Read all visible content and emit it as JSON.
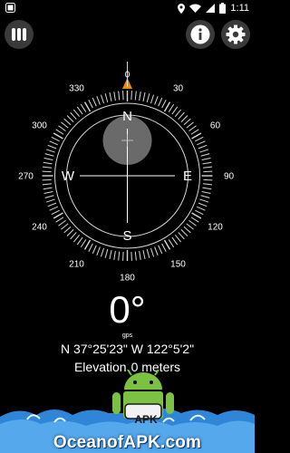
{
  "status_bar": {
    "time": "1:11",
    "icons": [
      "app-notification-icon",
      "location-icon",
      "wifi-icon",
      "signal-icon",
      "battery-icon"
    ]
  },
  "toolbar": {
    "menu_icon": "menu-icon",
    "info_icon": "info-icon",
    "settings_icon": "gear-icon"
  },
  "compass": {
    "cardinals": {
      "north": "N",
      "east": "E",
      "south": "S",
      "west": "W"
    },
    "degree_labels": [
      "0",
      "30",
      "60",
      "90",
      "120",
      "150",
      "180",
      "210",
      "240",
      "270",
      "300",
      "330"
    ],
    "colors": {
      "ring": "#d8d8d8",
      "marker": "#f08a00",
      "bubble": "#6a6a6a"
    }
  },
  "readout": {
    "heading": "0°",
    "gps_label": "gps",
    "coordinates": "N 37°25'23\" W 122°5'2\"",
    "elevation_label": "Elevation",
    "elevation_value": "0 meters"
  },
  "watermark": {
    "badge": "APK",
    "site": "OceanofAPK.com",
    "colors": {
      "android": "#7cc242",
      "wave": "#2f86d8"
    }
  }
}
